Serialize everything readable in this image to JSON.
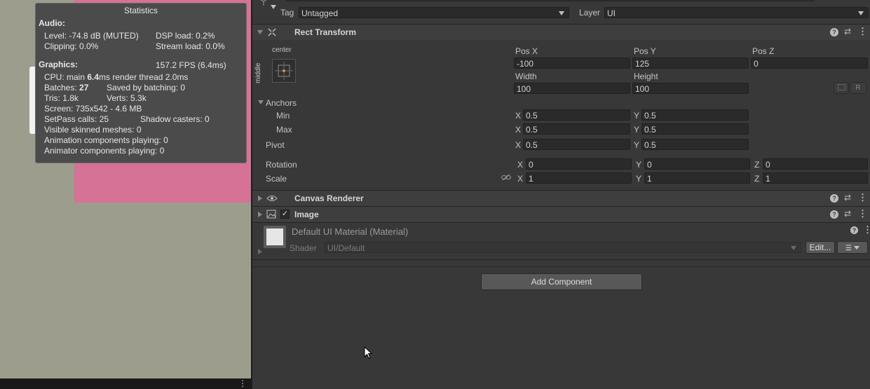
{
  "stats": {
    "title": "Statistics",
    "audio_header": "Audio:",
    "level": "Level: -74.8 dB (MUTED)",
    "dsp": "DSP load: 0.2%",
    "clipping": "Clipping: 0.0%",
    "stream": "Stream load: 0.0%",
    "graphics_header": "Graphics:",
    "fps": "157.2 FPS (6.4ms)",
    "cpu_prefix": "CPU: main ",
    "cpu_main": "6.4",
    "cpu_suffix": "ms  render thread 2.0ms",
    "batches_prefix": "Batches: ",
    "batches": "27",
    "saved": "Saved by batching: 0",
    "tris": "Tris: 1.8k",
    "verts": "Verts: 5.3k",
    "screen": "Screen: 735x542 - 4.6 MB",
    "setpass": "SetPass calls: 25",
    "shadow": "Shadow casters: 0",
    "skinned": "Visible skinned meshes: 0",
    "animation": "Animation components playing: 0",
    "animator": "Animator components playing: 0"
  },
  "game_view": {
    "menu_glyph": "⋮"
  },
  "inspector": {
    "tag_label": "Tag",
    "tag_value": "Untagged",
    "layer_label": "Layer",
    "layer_value": "UI",
    "rect_transform": {
      "title": "Rect Transform",
      "anchor_h": "center",
      "anchor_v": "middle",
      "pos_x_label": "Pos X",
      "pos_x": "-100",
      "pos_y_label": "Pos Y",
      "pos_y": "125",
      "pos_z_label": "Pos Z",
      "pos_z": "0",
      "width_label": "Width",
      "width": "100",
      "height_label": "Height",
      "height": "100",
      "raw_button": "R",
      "anchors_label": "Anchors",
      "min_label": "Min",
      "min_x": "0.5",
      "min_y": "0.5",
      "max_label": "Max",
      "max_x": "0.5",
      "max_y": "0.5",
      "pivot_label": "Pivot",
      "pivot_x": "0.5",
      "pivot_y": "0.5",
      "rotation_label": "Rotation",
      "rot_x": "0",
      "rot_y": "0",
      "rot_z": "0",
      "scale_label": "Scale",
      "scale_x": "1",
      "scale_y": "1",
      "scale_z": "1",
      "x": "X",
      "y": "Y",
      "z": "Z"
    },
    "canvas_renderer": {
      "title": "Canvas Renderer"
    },
    "image": {
      "title": "Image"
    },
    "material": {
      "name": "Default UI Material (Material)",
      "shader_label": "Shader",
      "shader_value": "UI/Default",
      "edit_button": "Edit..."
    },
    "add_component": "Add Component"
  }
}
